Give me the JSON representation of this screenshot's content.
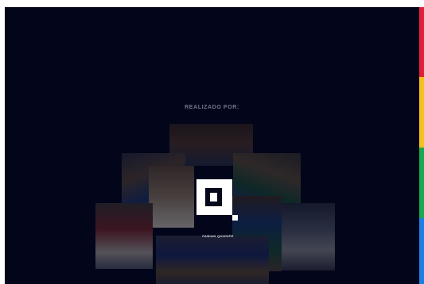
{
  "screen": {
    "title": "REALIZADO POR:",
    "brand_logo": "fabian-quizhpe-logo",
    "brand_name": "FABIAN QUIZHPE",
    "background_color": "#03061a"
  },
  "accent_bar": {
    "colors": [
      "#e21f3a",
      "#f4c21e",
      "#1ba84f",
      "#1c7ee8"
    ]
  },
  "mosaic_images": [
    "photo-tile",
    "photo-tile",
    "photo-tile",
    "photo-tile",
    "photo-tile",
    "photo-tile",
    "photo-tile",
    "photo-tile"
  ]
}
